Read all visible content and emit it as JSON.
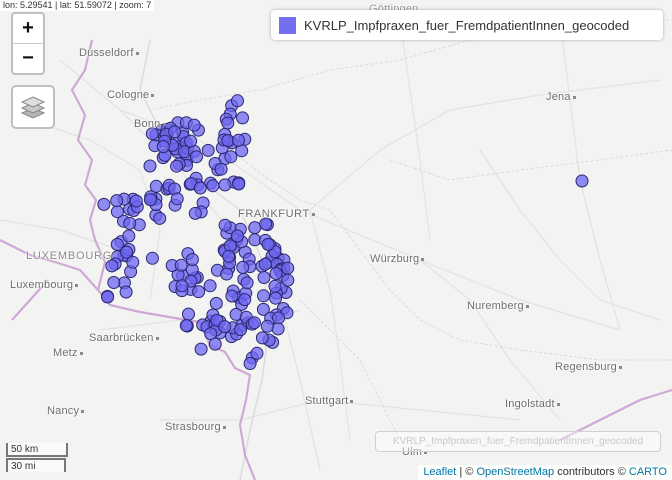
{
  "coord_readout": "lon: 5.29541 | lat: 51.59072 | zoom: 7",
  "zoom": {
    "in_label": "+",
    "out_label": "−"
  },
  "legend": {
    "label": "KVRLP_Impfpraxen_fuer_FremdpatientInnen_geocoded",
    "color": "#6d67f0"
  },
  "layer_name_box": "KVRLP_Impfpraxen_fuer_FremdpatientInnen_geocoded",
  "scale": {
    "km": "50 km",
    "mi": "30 mi"
  },
  "attribution": {
    "leaflet": "Leaflet",
    "sep1": " | © ",
    "osm": "OpenStreetMap",
    "mid": " contributors © ",
    "carto": "CARTO"
  },
  "places": {
    "gottingen": "Göttingen",
    "dusseldorf": "Dusseldorf",
    "cologne": "Cologne",
    "bonn": "Bonn",
    "jena": "Jena",
    "frankfurt": "FRANKFURT",
    "luxembourg_country": "LUXEMBOURG",
    "luxembourg_city": "Luxembourg",
    "wurzburg": "Würzburg",
    "nuremberg": "Nuremberg",
    "saarbrucken": "Saarbrücken",
    "metz": "Metz",
    "regensburg": "Regensburg",
    "stuttgart": "Stuttgart",
    "ingolstadt": "Ingolstadt",
    "nancy": "Nancy",
    "strasbourg": "Strasbourg",
    "ulm": "Ulm"
  },
  "icons": {
    "layers": "layers-icon"
  },
  "colors": {
    "marker_fill": "#6d67f0",
    "marker_stroke": "#2a2770",
    "land": "#f2f2f0",
    "border": "#c8a0d4"
  }
}
